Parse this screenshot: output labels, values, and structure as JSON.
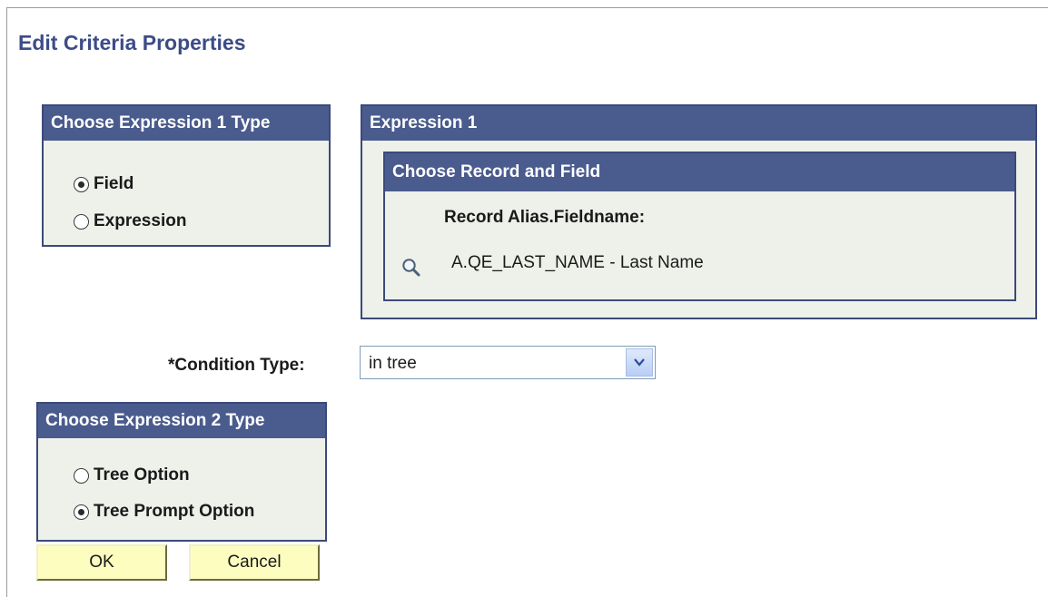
{
  "page": {
    "title": "Edit Criteria Properties"
  },
  "expr1_type": {
    "header": "Choose Expression 1 Type",
    "options": [
      {
        "label": "Field",
        "checked": true
      },
      {
        "label": "Expression",
        "checked": false
      }
    ]
  },
  "expr1": {
    "header": "Expression 1",
    "subheader": "Choose Record and Field",
    "field_label": "Record Alias.Fieldname:",
    "field_value": "A.QE_LAST_NAME - Last Name",
    "lookup_icon": "search-icon"
  },
  "condition": {
    "label": "*Condition Type:",
    "value": "in tree"
  },
  "expr2_type": {
    "header": "Choose Expression 2 Type",
    "options": [
      {
        "label": "Tree Option",
        "checked": false
      },
      {
        "label": "Tree Prompt Option",
        "checked": true
      }
    ]
  },
  "buttons": {
    "ok": "OK",
    "cancel": "Cancel"
  },
  "colors": {
    "header_bg": "#4a5b8d",
    "panel_bg": "#eef0ea",
    "title": "#3c4c87",
    "button_bg": "#fdfdc0"
  }
}
